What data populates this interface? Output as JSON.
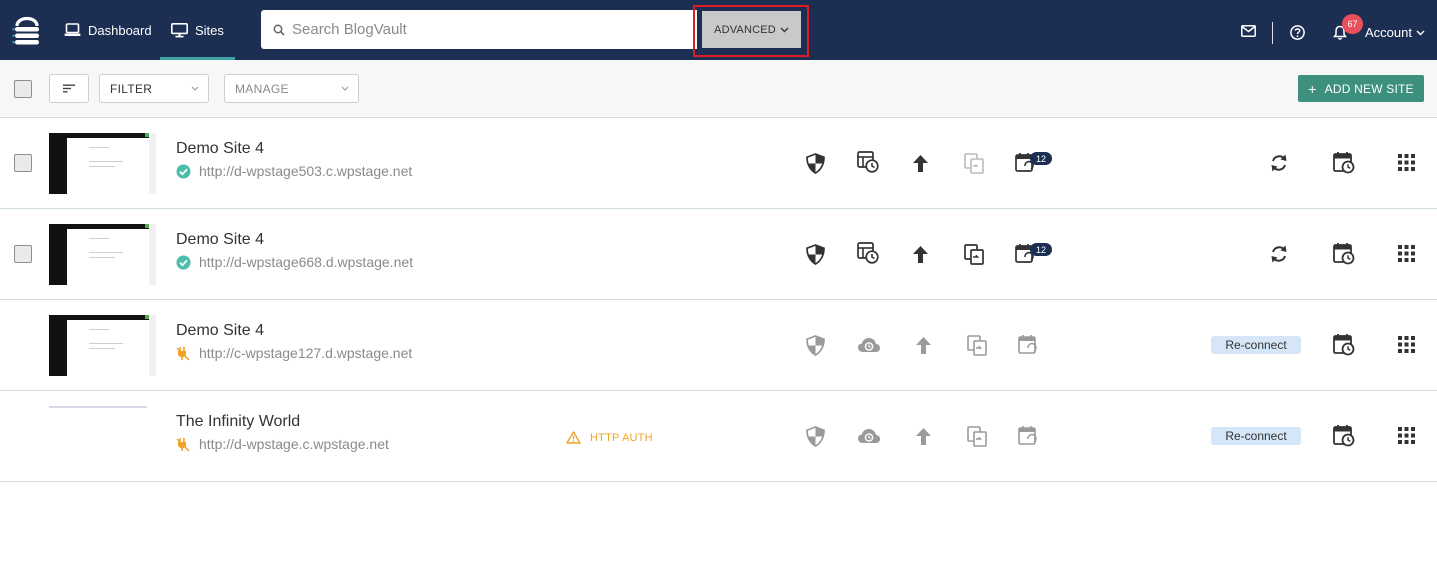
{
  "nav": {
    "dashboard_label": "Dashboard",
    "sites_label": "Sites",
    "search_placeholder": "Search BlogVault",
    "advanced_label": "ADVANCED",
    "notification_count": "67",
    "account_label": "Account",
    "colors": {
      "navbar": "#1c2e52",
      "active_underline": "#3fa3a6",
      "badge": "#e8505b",
      "highlight": "#e01b24"
    }
  },
  "toolbar": {
    "filter_label": "FILTER",
    "manage_label": "MANAGE",
    "add_site_label": "ADD NEW SITE",
    "add_site_icon": "plus-icon",
    "colors": {
      "add_site_bg": "#3d8f7e"
    }
  },
  "sites": [
    {
      "name": "Demo Site 4",
      "url": "http://d-wpstage503.c.wpstage.net",
      "status": "connected",
      "calendar_badge": "12",
      "has_checkbox": true,
      "reconnect_label": ""
    },
    {
      "name": "Demo Site 4",
      "url": "http://d-wpstage668.d.wpstage.net",
      "status": "connected",
      "calendar_badge": "12",
      "has_checkbox": true,
      "reconnect_label": ""
    },
    {
      "name": "Demo Site 4",
      "url": "http://c-wpstage127.d.wpstage.net",
      "status": "disconnected",
      "calendar_badge": "",
      "has_checkbox": false,
      "reconnect_label": "Re-connect"
    },
    {
      "name": "The Infinity World",
      "url": "http://d-wpstage.c.wpstage.net",
      "status": "disconnected",
      "calendar_badge": "",
      "has_checkbox": false,
      "reconnect_label": "Re-connect",
      "warning_label": "HTTP AUTH"
    }
  ],
  "icons": {
    "row_actions": [
      "shield-icon",
      "backup-history-icon",
      "upload-icon",
      "migrate-icon",
      "calendar-sync-icon",
      "refresh-icon",
      "schedule-icon",
      "apps-grid-icon"
    ],
    "status_connected": "check-circle-icon",
    "status_disconnected": "disconnected-plug-icon",
    "warning": "warning-icon",
    "colors": {
      "connected": "#4bbdaa",
      "disconnected": "#f0a323",
      "active_icon": "#333333",
      "inactive_icon": "#9a9a9a",
      "reconnect_bg": "#d4e6f7"
    }
  }
}
